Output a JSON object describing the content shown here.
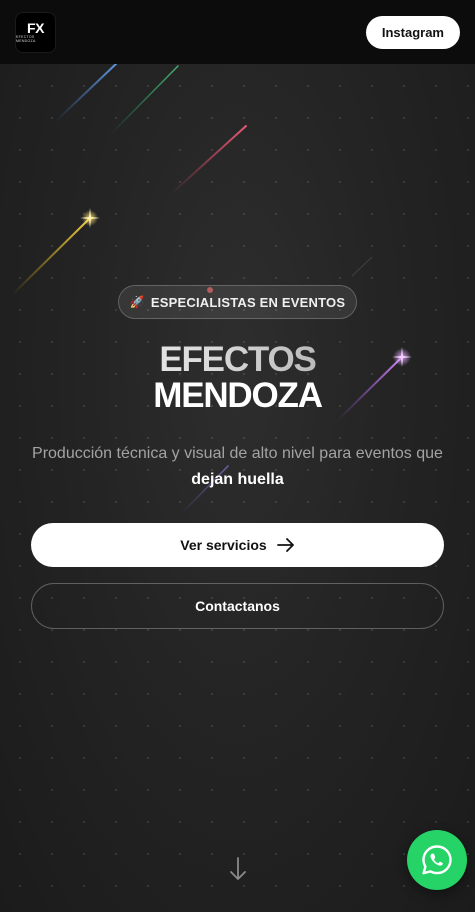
{
  "header": {
    "logo": {
      "mark": "FX",
      "sub": "EFECTOS MENDOZA"
    },
    "instagram_label": "Instagram"
  },
  "hero": {
    "badge_icon": "rocket-icon",
    "badge_label": "ESPECIALISTAS EN EVENTOS",
    "title_line1": "EFECTOS",
    "title_line2": "MENDOZA",
    "subtitle_text": "Producción técnica y visual de alto nivel para eventos que",
    "subtitle_highlight": "dejan huella"
  },
  "actions": {
    "primary_label": "Ver servicios",
    "primary_icon": "arrow-right-icon",
    "secondary_label": "Contactanos"
  },
  "scroll_icon": "arrow-down-icon",
  "whatsapp_icon": "whatsapp-icon",
  "colors": {
    "background": "#1f1f1f",
    "header": "#0c0c0c",
    "button_primary": "#ffffff",
    "whatsapp": "#25d366"
  }
}
